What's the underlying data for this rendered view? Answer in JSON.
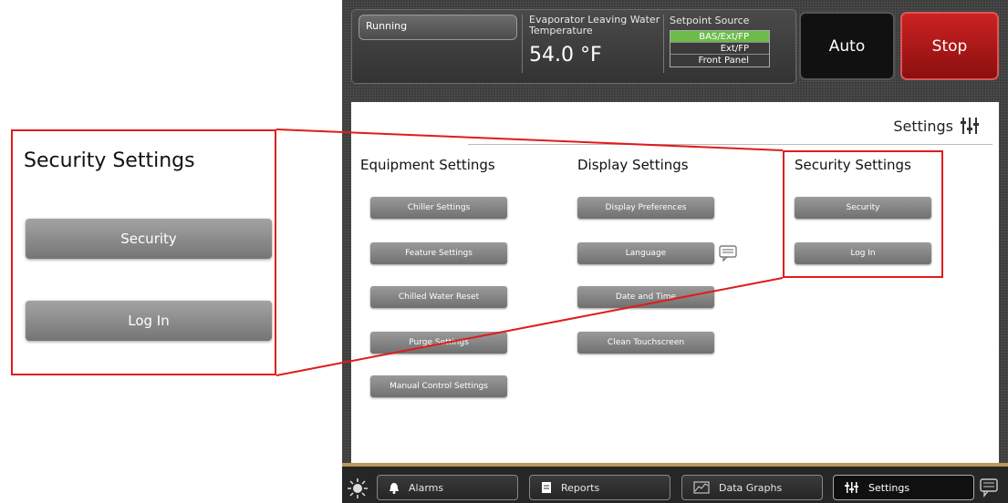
{
  "header": {
    "status": "Running",
    "temp_label": "Evaporator Leaving Water Temperature",
    "temp_value": "54.0 °F",
    "setpoint_label": "Setpoint Source",
    "setpoint_options": [
      "BAS/Ext/FP",
      "Ext/FP",
      "Front Panel"
    ],
    "setpoint_selected": "BAS/Ext/FP",
    "auto_label": "Auto",
    "stop_label": "Stop"
  },
  "nav": {
    "back_icon": "back-arrow-icon",
    "home_icon": "home-icon"
  },
  "page": {
    "title": "Settings",
    "title_icon": "sliders-icon"
  },
  "columns": [
    {
      "heading": "Equipment Settings",
      "buttons": [
        "Chiller Settings",
        "Feature Settings",
        "Chilled Water Reset",
        "Purge Settings",
        "Manual Control Settings"
      ]
    },
    {
      "heading": "Display Settings",
      "buttons": [
        "Display Preferences",
        "Language",
        "Date and Time",
        "Clean Touchscreen"
      ]
    },
    {
      "heading": "Security Settings",
      "buttons": [
        "Security",
        "Log In"
      ]
    }
  ],
  "callout": {
    "heading": "Security Settings",
    "buttons": [
      "Security",
      "Log In"
    ]
  },
  "footer": {
    "tabs": [
      {
        "label": "Alarms",
        "icon": "bell-icon"
      },
      {
        "label": "Reports",
        "icon": "document-icon"
      },
      {
        "label": "Data Graphs",
        "icon": "graph-icon"
      },
      {
        "label": "Settings",
        "icon": "sliders-icon",
        "active": true
      }
    ]
  },
  "colors": {
    "highlight": "#e01b1b",
    "stop": "#b81c1c",
    "selected_source": "#6dbb4a"
  }
}
